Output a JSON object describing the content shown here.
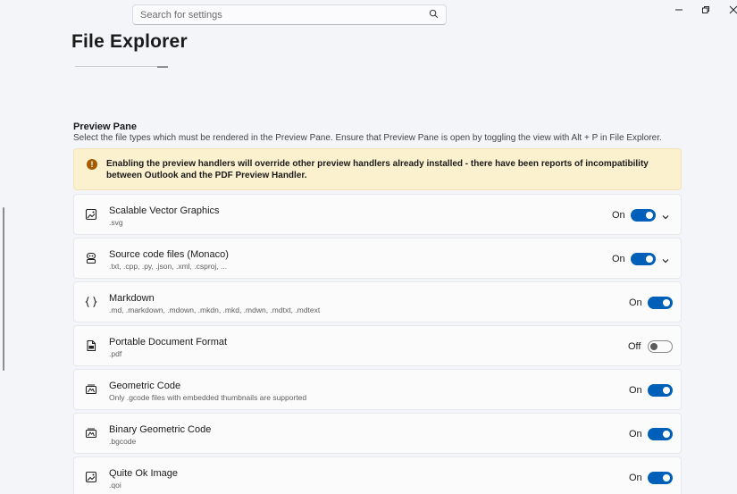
{
  "search": {
    "placeholder": "Search for settings"
  },
  "page": {
    "title": "File Explorer"
  },
  "preview_pane": {
    "title": "Preview Pane",
    "description": "Select the file types which must be rendered in the Preview Pane. Ensure that Preview Pane is open by toggling the view with Alt + P in File Explorer.",
    "warning": "Enabling the preview handlers will override other preview handlers already installed - there have been reports of incompatibility between Outlook and the PDF Preview Handler.",
    "items": [
      {
        "title": "Scalable Vector Graphics",
        "sub": ".svg",
        "state": "On",
        "icon": "image-icon",
        "expandable": true
      },
      {
        "title": "Source code files (Monaco)",
        "sub": ".txt, .cpp, .py, .json, .xml, .csproj, ...",
        "state": "On",
        "icon": "code-icon",
        "expandable": true
      },
      {
        "title": "Markdown",
        "sub": ".md, .markdown, .mdown, .mkdn, .mkd, .mdwn, .mdtxt, .mdtext",
        "state": "On",
        "icon": "braces-icon",
        "expandable": false
      },
      {
        "title": "Portable Document Format",
        "sub": ".pdf",
        "state": "Off",
        "icon": "pdf-icon",
        "expandable": false
      },
      {
        "title": "Geometric Code",
        "sub": "Only .gcode files with embedded thumbnails are supported",
        "state": "On",
        "icon": "printer-icon",
        "expandable": false
      },
      {
        "title": "Binary Geometric Code",
        "sub": ".bgcode",
        "state": "On",
        "icon": "printer-icon",
        "expandable": false
      },
      {
        "title": "Quite Ok Image",
        "sub": ".qoi",
        "state": "On",
        "icon": "image-icon",
        "expandable": false
      }
    ]
  },
  "colors": {
    "accent": "#005fb8",
    "warning_bg": "#fcf1cf",
    "background": "#f3f5f9"
  }
}
